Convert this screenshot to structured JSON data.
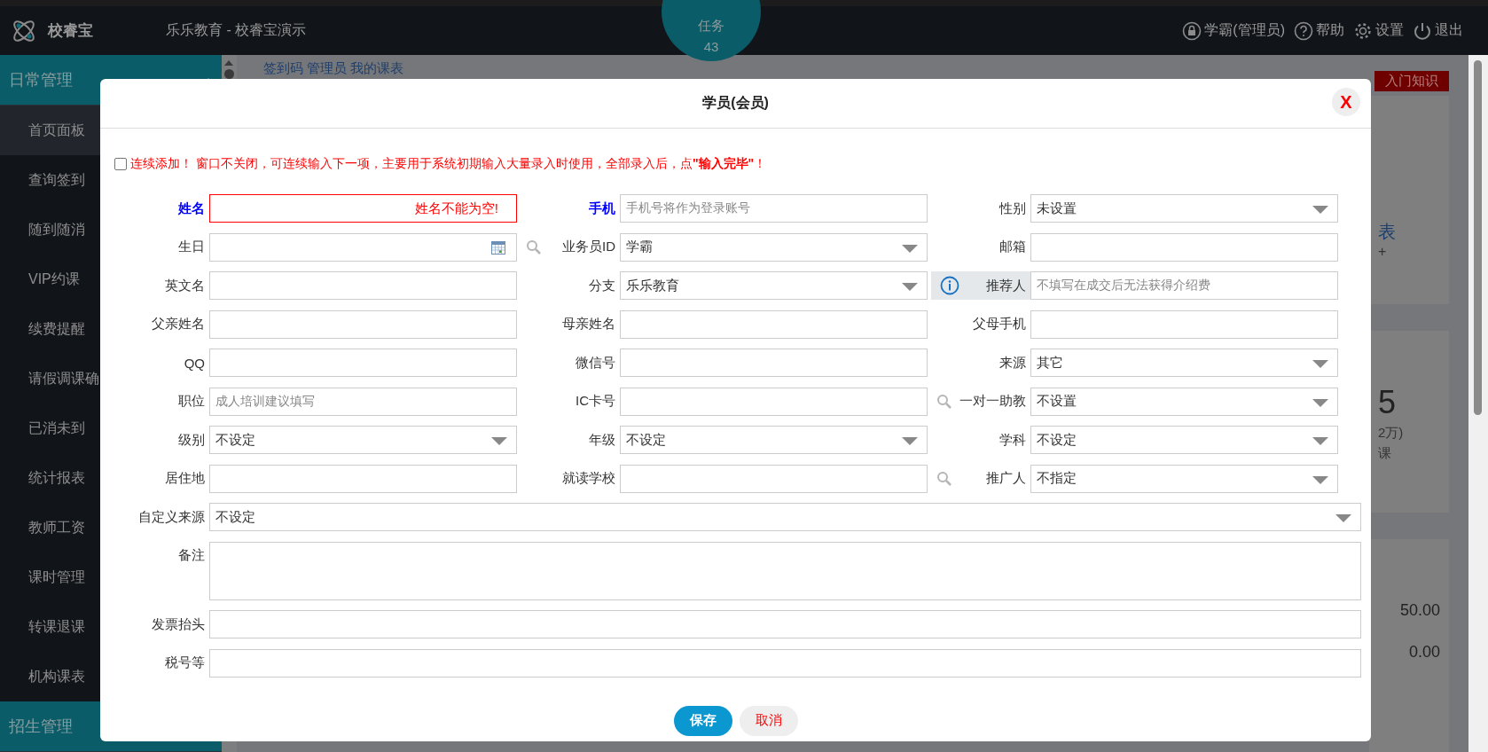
{
  "topbar": {
    "logo": "校睿宝",
    "org": "乐乐教育 - 校睿宝演示",
    "task": {
      "label": "任务",
      "count": "43"
    },
    "actions": [
      {
        "kind": "lock",
        "label": "学霸(管理员)"
      },
      {
        "kind": "help",
        "label": "帮助"
      },
      {
        "kind": "settings",
        "label": "设置"
      },
      {
        "kind": "power",
        "label": "退出"
      }
    ]
  },
  "sidebar": {
    "groups": [
      {
        "label": "日常管理",
        "expanded": true,
        "items": [
          {
            "label": "首页面板",
            "selected": true
          },
          {
            "label": "查询签到",
            "selected": false
          },
          {
            "label": "随到随消",
            "selected": false
          },
          {
            "label": "VIP约课",
            "selected": false
          },
          {
            "label": "续费提醒",
            "selected": false
          },
          {
            "label": "请假调课确",
            "selected": false
          },
          {
            "label": "已消未到",
            "selected": false
          },
          {
            "label": "统计报表",
            "selected": false
          },
          {
            "label": "教师工资",
            "selected": false
          },
          {
            "label": "课时管理",
            "selected": false
          },
          {
            "label": "转课退课",
            "selected": false
          },
          {
            "label": "机构课表",
            "selected": false
          }
        ]
      },
      {
        "label": "招生管理",
        "expanded": false
      }
    ]
  },
  "main": {
    "links": "签到码 管理员 我的课表",
    "intro_button": "入门知识",
    "cards": [
      {
        "lines": [
          {
            "kind": "link",
            "text": "表"
          },
          {
            "kind": "plus",
            "text": "+"
          }
        ]
      },
      {
        "lines": [
          {
            "kind": "big",
            "text": "5"
          },
          {
            "kind": "small",
            "text": "2万)"
          },
          {
            "kind": "small",
            "text": "课"
          }
        ]
      },
      {
        "lines": [
          {
            "kind": "amount",
            "text": "50.00"
          },
          {
            "kind": "amount",
            "text": "0.00"
          }
        ]
      }
    ]
  },
  "dialog": {
    "title": "学员(会员)",
    "close": "X",
    "continuous": {
      "checked": false,
      "text": "连续添加！ 窗口不关闭，可连续输入下一项，主要用于系统初期输入大量录入时使用，全部录入后，点**\"输入完毕\"**！"
    },
    "fields": [
      {
        "label": "姓名",
        "kind": "text",
        "required": true,
        "error": "姓名不能为空!"
      },
      {
        "label": "手机",
        "kind": "text",
        "required": true,
        "placeholder": "手机号将作为登录账号"
      },
      {
        "label": "性别",
        "kind": "select",
        "value": "未设置"
      },
      {
        "label": "生日",
        "kind": "date"
      },
      {
        "label": "业务员ID",
        "kind": "select",
        "lookup": true,
        "value": "学霸"
      },
      {
        "label": "邮箱",
        "kind": "text"
      },
      {
        "label": "英文名",
        "kind": "text"
      },
      {
        "label": "分支",
        "kind": "select",
        "value": "乐乐教育"
      },
      {
        "label": "推荐人",
        "kind": "text",
        "info": true,
        "placeholder": "不填写在成交后无法获得介绍费"
      },
      {
        "label": "父亲姓名",
        "kind": "text"
      },
      {
        "label": "母亲姓名",
        "kind": "text"
      },
      {
        "label": "父母手机",
        "kind": "text"
      },
      {
        "label": "QQ",
        "kind": "text"
      },
      {
        "label": "微信号",
        "kind": "text"
      },
      {
        "label": "来源",
        "kind": "select",
        "value": "其它"
      },
      {
        "label": "职位",
        "kind": "text",
        "placeholder": "成人培训建议填写"
      },
      {
        "label": "IC卡号",
        "kind": "text"
      },
      {
        "label": "一对一助教",
        "kind": "select",
        "lookup": true,
        "value": "不设置"
      },
      {
        "label": "级别",
        "kind": "select",
        "value": "不设定"
      },
      {
        "label": "年级",
        "kind": "select",
        "value": "不设定"
      },
      {
        "label": "学科",
        "kind": "select",
        "value": "不设定"
      },
      {
        "label": "居住地",
        "kind": "text"
      },
      {
        "label": "就读学校",
        "kind": "text"
      },
      {
        "label": "推广人",
        "kind": "select",
        "lookup": true,
        "value": "不指定"
      }
    ],
    "wide_fields": [
      {
        "label": "自定义来源",
        "kind": "select",
        "value": "不设定"
      },
      {
        "label": "备注",
        "kind": "textarea"
      },
      {
        "label": "发票抬头",
        "kind": "text"
      },
      {
        "label": "税号等",
        "kind": "text"
      }
    ],
    "buttons": [
      {
        "kind": "primary",
        "label": "保存"
      },
      {
        "kind": "cancel",
        "label": "取消"
      }
    ]
  }
}
